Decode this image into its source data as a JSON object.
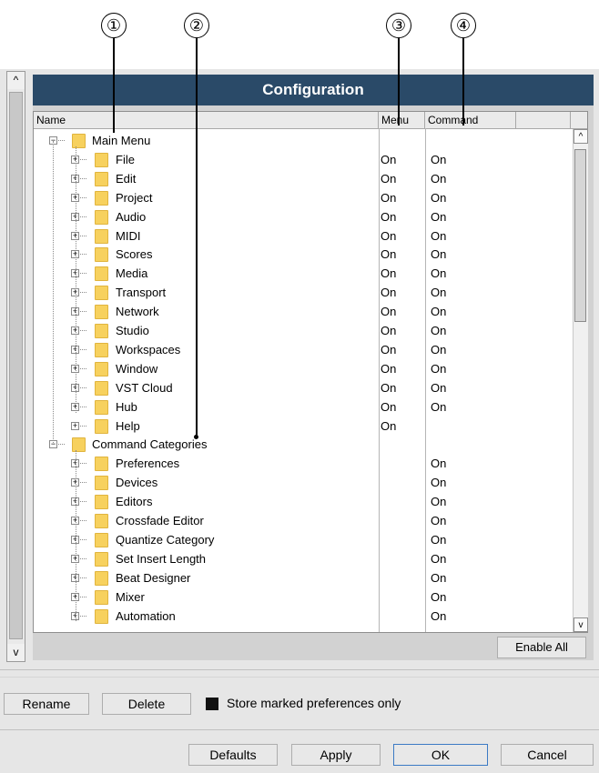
{
  "callouts": [
    "①",
    "②",
    "③",
    "④"
  ],
  "window": {
    "title": "Configuration",
    "columns": {
      "name": "Name",
      "menu": "Menu",
      "command": "Command"
    }
  },
  "tree": [
    {
      "label": "Main Menu",
      "level": 0,
      "menu": "",
      "command": ""
    },
    {
      "label": "File",
      "level": 1,
      "menu": "On",
      "command": "On"
    },
    {
      "label": "Edit",
      "level": 1,
      "menu": "On",
      "command": "On"
    },
    {
      "label": "Project",
      "level": 1,
      "menu": "On",
      "command": "On"
    },
    {
      "label": "Audio",
      "level": 1,
      "menu": "On",
      "command": "On"
    },
    {
      "label": "MIDI",
      "level": 1,
      "menu": "On",
      "command": "On"
    },
    {
      "label": "Scores",
      "level": 1,
      "menu": "On",
      "command": "On"
    },
    {
      "label": "Media",
      "level": 1,
      "menu": "On",
      "command": "On"
    },
    {
      "label": "Transport",
      "level": 1,
      "menu": "On",
      "command": "On"
    },
    {
      "label": "Network",
      "level": 1,
      "menu": "On",
      "command": "On"
    },
    {
      "label": "Studio",
      "level": 1,
      "menu": "On",
      "command": "On"
    },
    {
      "label": "Workspaces",
      "level": 1,
      "menu": "On",
      "command": "On"
    },
    {
      "label": "Window",
      "level": 1,
      "menu": "On",
      "command": "On"
    },
    {
      "label": "VST Cloud",
      "level": 1,
      "menu": "On",
      "command": "On"
    },
    {
      "label": "Hub",
      "level": 1,
      "menu": "On",
      "command": "On"
    },
    {
      "label": "Help",
      "level": 1,
      "menu": "On",
      "command": ""
    },
    {
      "label": "Command Categories",
      "level": 0,
      "menu": "",
      "command": ""
    },
    {
      "label": "Preferences",
      "level": 1,
      "menu": "",
      "command": "On"
    },
    {
      "label": "Devices",
      "level": 1,
      "menu": "",
      "command": "On"
    },
    {
      "label": "Editors",
      "level": 1,
      "menu": "",
      "command": "On"
    },
    {
      "label": "Crossfade Editor",
      "level": 1,
      "menu": "",
      "command": "On"
    },
    {
      "label": "Quantize Category",
      "level": 1,
      "menu": "",
      "command": "On"
    },
    {
      "label": "Set Insert Length",
      "level": 1,
      "menu": "",
      "command": "On"
    },
    {
      "label": "Beat Designer",
      "level": 1,
      "menu": "",
      "command": "On"
    },
    {
      "label": "Mixer",
      "level": 1,
      "menu": "",
      "command": "On"
    },
    {
      "label": "Automation",
      "level": 1,
      "menu": "",
      "command": "On"
    }
  ],
  "buttons": {
    "enable_all": "Enable All",
    "rename": "Rename",
    "delete": "Delete",
    "store_marked": "Store marked preferences only",
    "defaults": "Defaults",
    "apply": "Apply",
    "ok": "OK",
    "cancel": "Cancel"
  },
  "glyphs": {
    "up": "^",
    "down": "v",
    "plus": "+",
    "minus": "−"
  },
  "colors": {
    "titlebar": "#2a4a68",
    "folder": "#f7d15e"
  }
}
